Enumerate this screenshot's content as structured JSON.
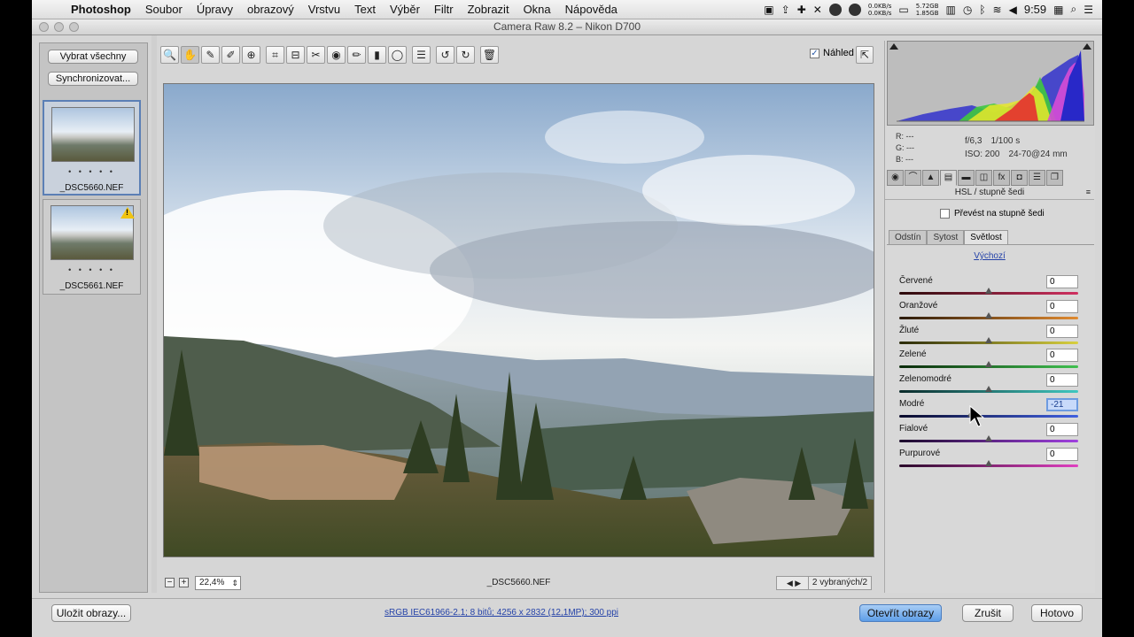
{
  "menubar": {
    "app_name": "Photoshop",
    "items": [
      "Soubor",
      "Úpravy",
      "obrazový",
      "Vrstvu",
      "Text",
      "Výběr",
      "Filtr",
      "Zobrazit",
      "Okna",
      "Nápověda"
    ],
    "net_up": "0.0KB/s",
    "net_down": "0.0KB/s",
    "mem_used": "5.72GB",
    "mem_free": "1.85GB",
    "clock": "9:59"
  },
  "window": {
    "title": "Camera Raw 8.2  –  Nikon D700"
  },
  "filmstrip": {
    "select_all_label": "Vybrat všechny",
    "sync_label": "Synchronizovat...",
    "items": [
      {
        "name": "_DSC5660.NEF",
        "rating": "• • • • •",
        "warning": false
      },
      {
        "name": "_DSC5661.NEF",
        "rating": "• • • • •",
        "warning": true
      }
    ]
  },
  "toolbar": {
    "tools": [
      {
        "name": "zoom-tool",
        "glyph": "🔍"
      },
      {
        "name": "hand-tool",
        "glyph": "✋"
      },
      {
        "name": "white-balance-tool",
        "glyph": "✎"
      },
      {
        "name": "color-sampler-tool",
        "glyph": "✐"
      },
      {
        "name": "targeted-adjustment-tool",
        "glyph": "⊕"
      },
      {
        "name": "crop-tool",
        "glyph": "⌗"
      },
      {
        "name": "straighten-tool",
        "glyph": "⊟"
      },
      {
        "name": "spot-removal-tool",
        "glyph": "✂"
      },
      {
        "name": "red-eye-tool",
        "glyph": "◉"
      },
      {
        "name": "adjustment-brush-tool",
        "glyph": "✏"
      },
      {
        "name": "graduated-filter-tool",
        "glyph": "▮"
      },
      {
        "name": "radial-filter-tool",
        "glyph": "◯"
      },
      {
        "name": "preferences-tool",
        "glyph": "☰"
      },
      {
        "name": "rotate-left-tool",
        "glyph": "↺"
      },
      {
        "name": "rotate-right-tool",
        "glyph": "↻"
      },
      {
        "name": "trash-tool",
        "glyph": "🗑"
      }
    ],
    "preview_label": "Náhled",
    "preview_checked": "✓"
  },
  "statusbar": {
    "zoom": "22,4%",
    "filename": "_DSC5660.NEF",
    "selection": "2 vybraných/2"
  },
  "info": {
    "r": "R:  ---",
    "g": "G:  ---",
    "b": "B:  ---",
    "aperture": "f/6,3",
    "shutter": "1/100 s",
    "iso": "ISO: 200",
    "lens": "24-70@24 mm"
  },
  "panel": {
    "title": "HSL / stupně šedi",
    "grayscale_label": "Převést na stupně šedi",
    "subtabs": [
      "Odstín",
      "Sytost",
      "Světlost"
    ],
    "active_subtab": 2,
    "default_link": "Výchozí",
    "sliders": [
      {
        "label": "Červené",
        "value": "0",
        "norm": 0.5,
        "gradient": "linear-gradient(90deg,#2a0a0a,#d03060)"
      },
      {
        "label": "Oranžové",
        "value": "0",
        "norm": 0.5,
        "gradient": "linear-gradient(90deg,#2a1a0a,#e08a30)"
      },
      {
        "label": "Žluté",
        "value": "0",
        "norm": 0.5,
        "gradient": "linear-gradient(90deg,#2a2a0a,#d8d040)"
      },
      {
        "label": "Zelené",
        "value": "0",
        "norm": 0.5,
        "gradient": "linear-gradient(90deg,#0a2a0a,#40c050)"
      },
      {
        "label": "Zelenomodré",
        "value": "0",
        "norm": 0.5,
        "gradient": "linear-gradient(90deg,#0a2a2a,#40c8c0)"
      },
      {
        "label": "Modré",
        "value": "-21",
        "norm": 0.4,
        "gradient": "linear-gradient(90deg,#0a0a2a,#4060e0)",
        "focused": true
      },
      {
        "label": "Fialové",
        "value": "0",
        "norm": 0.5,
        "gradient": "linear-gradient(90deg,#1a0a2a,#a040e0)"
      },
      {
        "label": "Purpurové",
        "value": "0",
        "norm": 0.5,
        "gradient": "linear-gradient(90deg,#2a0a2a,#e040c0)"
      }
    ]
  },
  "bottom": {
    "save_label": "Uložit obrazy...",
    "workflow_link": "sRGB IEC61966-2.1; 8 bitů; 4256 x 2832 (12,1MP); 300 ppi",
    "open_label": "Otevřít obrazy",
    "cancel_label": "Zrušit",
    "done_label": "Hotovo"
  },
  "colors": {
    "accent": "#5e9ee8",
    "link": "#2442a8"
  }
}
